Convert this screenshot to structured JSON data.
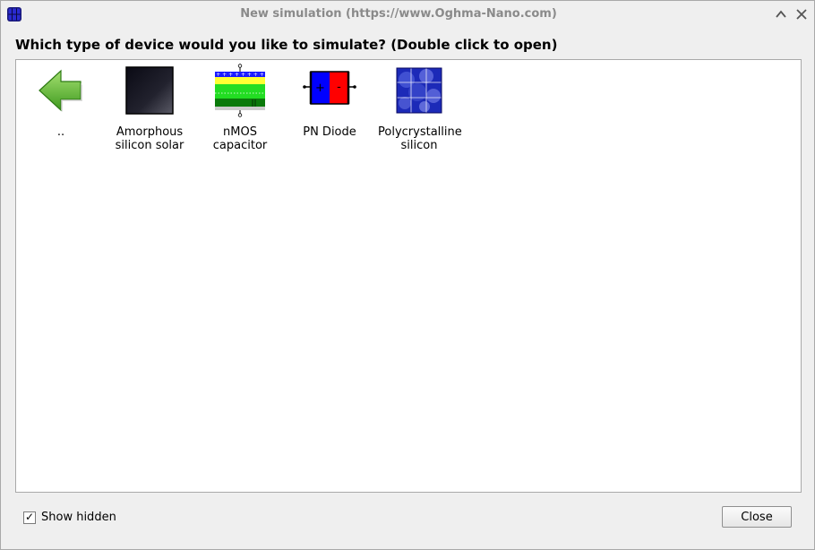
{
  "window": {
    "title": "New simulation (https://www.Oghma-Nano.com)"
  },
  "heading": "Which type of device would you like to simulate? (Double click to open)",
  "items": [
    {
      "label": "..",
      "icon": "back-arrow-icon"
    },
    {
      "label": "Amorphous silicon solar cell",
      "icon": "amorphous-silicon-icon"
    },
    {
      "label": "nMOS capacitor",
      "icon": "nmos-capacitor-icon"
    },
    {
      "label": "PN Diode",
      "icon": "pn-diode-icon"
    },
    {
      "label": "Polycrystalline silicon",
      "icon": "polycrystalline-silicon-icon"
    }
  ],
  "footer": {
    "show_hidden_label": "Show hidden",
    "show_hidden_checked": "✓",
    "close_label": "Close"
  },
  "colors": {
    "panel_border": "#a9a9a9",
    "title_text": "#8a8a8a",
    "pn_p": "#0000ff",
    "pn_n": "#ff0000"
  }
}
